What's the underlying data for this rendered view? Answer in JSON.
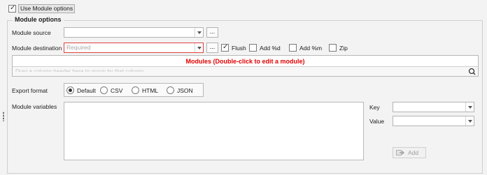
{
  "use_module_options": {
    "label": "Use Module options",
    "checked": true
  },
  "group_title": "Module options",
  "module_source": {
    "label": "Module source",
    "value": ""
  },
  "module_destination": {
    "label": "Module destination",
    "placeholder": "Required"
  },
  "ellipsis_label": "...",
  "flush": {
    "label": "Flush",
    "checked": true
  },
  "add_d": {
    "label": "Add %d",
    "checked": false
  },
  "add_m": {
    "label": "Add %m",
    "checked": false
  },
  "zip": {
    "label": "Zip",
    "checked": false
  },
  "modules_banner": "Modules (Double-click to edit a module)",
  "grid_hint": "Drag a column header here to group by that column",
  "export_format": {
    "label": "Export format",
    "options": [
      "Default",
      "CSV",
      "HTML",
      "JSON"
    ],
    "selected": "Default"
  },
  "module_variables": {
    "label": "Module variables"
  },
  "key": {
    "label": "Key",
    "value": ""
  },
  "value": {
    "label": "Value",
    "value": ""
  },
  "add_button": "Add",
  "colors": {
    "required_border": "#e04040",
    "banner_text": "#e00000"
  }
}
